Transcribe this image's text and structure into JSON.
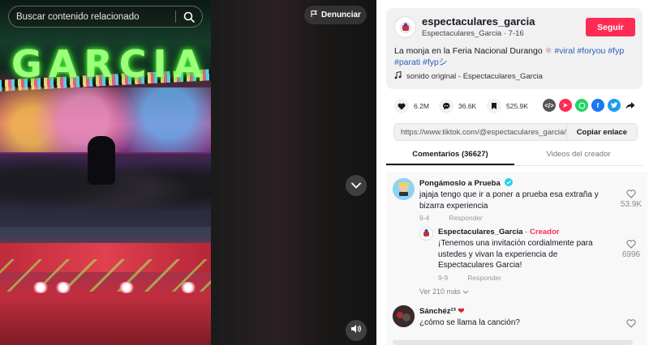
{
  "search": {
    "placeholder": "Buscar contenido relacionado"
  },
  "video": {
    "report_label": "Denunciar",
    "sign_text": "GARCIA"
  },
  "post": {
    "username": "espectaculares_garcia",
    "display_name": "Espectaculares_Garcia",
    "date": "7-16",
    "follow_label": "Seguir",
    "description": "La monja en la Feria Nacional Durango",
    "hashtags": [
      "#viral",
      "#foryou",
      "#fyp",
      "#parati",
      "#fypシ"
    ],
    "sound": "sonido original - Espectaculares_Garcia"
  },
  "stats": {
    "likes": "6.2M",
    "comments": "36.6K",
    "saves": "525.9K"
  },
  "share_icons": [
    "embed-icon",
    "send-icon",
    "whatsapp-icon",
    "facebook-icon",
    "twitter-icon",
    "share-arrow-icon"
  ],
  "link": {
    "url": "https://www.tiktok.com/@espectaculares_garcia/...",
    "copy_label": "Copiar enlace"
  },
  "tabs": [
    {
      "label": "Comentarios (36627)",
      "active": true
    },
    {
      "label": "Videos del creador",
      "active": false
    }
  ],
  "comments": [
    {
      "user": "Pongámoslo a Prueba",
      "verified": true,
      "text": "jajaja tengo que ir a poner a prueba esa extraña y bizarra experiencia",
      "date": "9-4",
      "reply_label": "Responder",
      "likes": "53.9K"
    },
    {
      "user": "Espectaculares_Garcia",
      "creator_label": "Creador",
      "text": "¡Tenemos una invitación cordialmente para ustedes y vivan la experiencia de Espectaculares Garcia!",
      "date": "9-9",
      "reply_label": "Responder",
      "likes": "6996"
    },
    {
      "user": "Sánchéz²³",
      "text": "¿cómo se llama la canción?"
    }
  ],
  "more_replies": "Ver 210 más",
  "colors": {
    "accent": "#fe2c55",
    "hashtag": "#2b5db9"
  }
}
